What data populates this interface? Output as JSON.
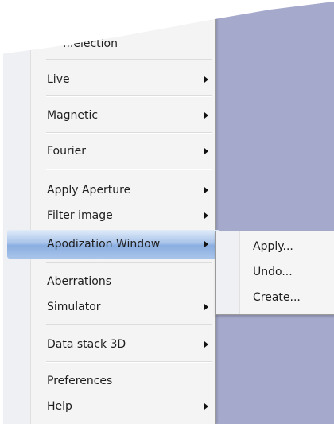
{
  "context_menu": {
    "partial_top_label": "...election",
    "items": [
      {
        "label": "Live",
        "has_submenu": true
      },
      {
        "label": "Magnetic",
        "has_submenu": true
      },
      {
        "label": "Fourier",
        "has_submenu": true
      },
      {
        "label": "Apply Aperture",
        "has_submenu": true
      },
      {
        "label": "Filter image",
        "has_submenu": true
      },
      {
        "label": "Apodization Window",
        "has_submenu": true,
        "highlighted": true
      },
      {
        "label": "Aberrations",
        "has_submenu": false
      },
      {
        "label": "Simulator",
        "has_submenu": true
      },
      {
        "label": "Data stack 3D",
        "has_submenu": true
      },
      {
        "label": "Preferences",
        "has_submenu": false
      },
      {
        "label": "Help",
        "has_submenu": true
      }
    ]
  },
  "submenu": {
    "parent": "Apodization Window",
    "items": [
      {
        "label": "Apply..."
      },
      {
        "label": "Undo..."
      },
      {
        "label": "Create..."
      }
    ]
  },
  "colors": {
    "desktop_bg": "#a5a9cb",
    "menu_bg": "#f4f4f4",
    "highlight": "#a9c4ea"
  }
}
